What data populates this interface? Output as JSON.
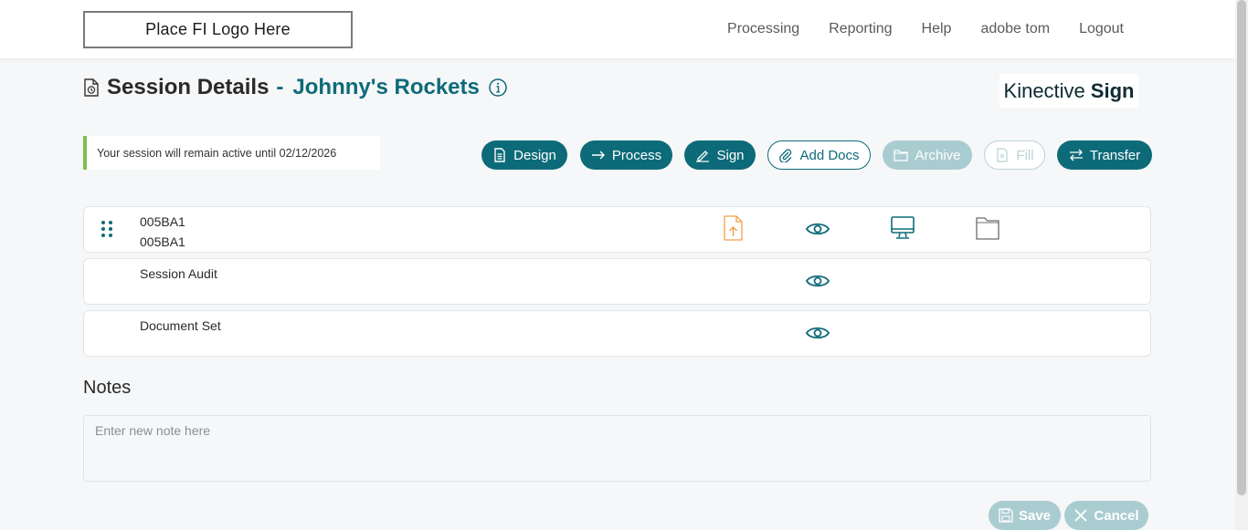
{
  "header": {
    "logo_text": "Place FI Logo Here",
    "nav": [
      "Processing",
      "Reporting",
      "Help",
      "adobe tom",
      "Logout"
    ]
  },
  "page": {
    "title": "Session Details",
    "separator": "-",
    "session_name": "Johnny's Rockets",
    "brand_light": "Kinective",
    "brand_bold": "Sign",
    "notice": "Your session will remain active until 02/12/2026"
  },
  "actions": {
    "design": "Design",
    "process": "Process",
    "sign": "Sign",
    "add_docs": "Add Docs",
    "archive": "Archive",
    "fill": "Fill",
    "transfer": "Transfer"
  },
  "documents": [
    {
      "line1": "005BA1",
      "line2": "005BA1"
    },
    {
      "line1": "Session Audit"
    },
    {
      "line1": "Document Set"
    }
  ],
  "notes": {
    "title": "Notes",
    "placeholder": "Enter new note here"
  },
  "footer": {
    "save": "Save",
    "cancel": "Cancel"
  },
  "colors": {
    "primary": "#0d6b79",
    "disabled": "#a9ccd1",
    "notice_accent": "#7cc24a",
    "upload_icon": "#f0a04b"
  },
  "icons": {
    "upload": "file-upload-icon",
    "view": "eye-icon",
    "screen": "monitor-icon",
    "folder": "folder-icon",
    "drag": "drag-handle-icon"
  }
}
